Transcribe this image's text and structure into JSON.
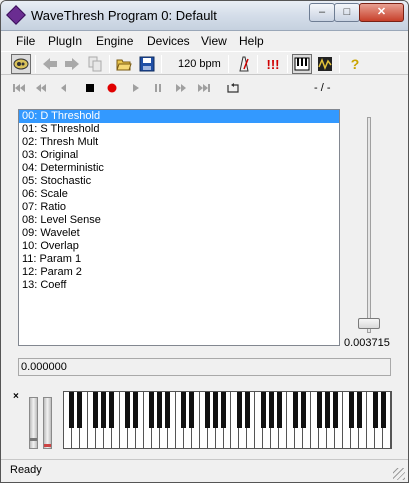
{
  "window": {
    "title": "WaveThresh Program 0: Default",
    "controls": {
      "minimize": "–",
      "maximize": "□",
      "close": "✕"
    }
  },
  "menu": [
    "File",
    "PlugIn",
    "Engine",
    "Devices",
    "View",
    "Help"
  ],
  "toolbar": {
    "tempo": "120 bpm",
    "icons": [
      "settings-icon",
      "back-arrow-icon",
      "forward-arrow-icon",
      "copy-icon",
      "open-folder-icon",
      "save-icon",
      "metronome-icon",
      "panic-icon",
      "keyboard-view-icon",
      "wave-view-icon",
      "help-icon"
    ],
    "panic_label": "!!!",
    "help_label": "?"
  },
  "transport": {
    "position": "- / -",
    "icons": [
      "rewind-start-icon",
      "rewind-icon",
      "step-back-icon",
      "stop-icon",
      "record-icon",
      "play-icon",
      "pause-icon",
      "fast-forward-icon",
      "forward-end-icon",
      "loop-icon"
    ]
  },
  "params": [
    "00: D Threshold",
    "01: S Threshold",
    "02: Thresh Mult",
    "03: Original",
    "04: Deterministic",
    "05: Stochastic",
    "06: Scale",
    "07: Ratio",
    "08: Level Sense",
    "09: Wavelet",
    "10: Overlap",
    "11: Param 1",
    "12: Param 2",
    "13: Coeff"
  ],
  "selected_param_index": 0,
  "slider": {
    "value_text": "0.003715",
    "level_fraction": 0.0
  },
  "value_field": "0.000000",
  "keyboard": {
    "close_label": "×",
    "white_key_count": 41
  },
  "status": "Ready",
  "colors": {
    "selection": "#3399ff",
    "record": "#e00000",
    "panic": "#d00000"
  }
}
